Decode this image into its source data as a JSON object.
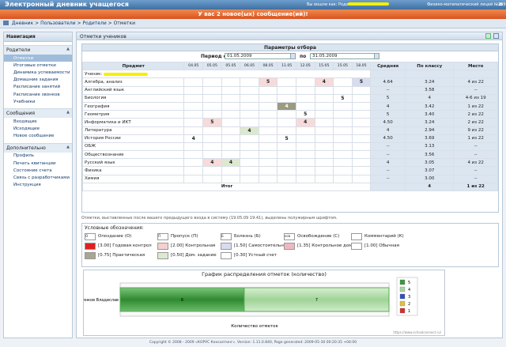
{
  "header": {
    "app_title": "Электронный дневник учащегося",
    "login_prefix": "Вы вошли как: Родители",
    "school": "Физико-математический лицей №239",
    "exit_label": "Выход"
  },
  "message_bar": "У вас 2 новое(ых) сообщение(ий)!",
  "breadcrumb": [
    "Дневник",
    "Пользователи",
    "Родители",
    "Отметки"
  ],
  "sidebar": {
    "title": "Навигация",
    "groups": [
      {
        "label": "Родители",
        "items": [
          "Отметки",
          "Итоговые отметки",
          "Динамика успеваемости",
          "Домашние задания",
          "Расписание занятий",
          "Расписание звонков",
          "Учебники"
        ]
      },
      {
        "label": "Сообщения",
        "items": [
          "Входящие",
          "Исходящие",
          "Новое сообщение"
        ]
      },
      {
        "label": "Дополнительно",
        "items": [
          "Профиль",
          "Печать квитанции",
          "Состояние счета",
          "Связь с разработчиками",
          "Инструкция"
        ]
      }
    ]
  },
  "main": {
    "title": "Отметки учеников",
    "params_title": "Параметры отбора",
    "period_from_label": "Период с",
    "period_from": "01.05.2009",
    "period_to_label": "по",
    "period_to": "31.05.2009"
  },
  "grades": {
    "headers": {
      "subject": "Предмет",
      "avg": "Средняя",
      "class": "По классу",
      "place": "Место"
    },
    "dates": [
      "04.05",
      "05.05",
      "05.05",
      "06.05",
      "08.05",
      "11.05",
      "12.05",
      "15.05",
      "15.05",
      "18.05"
    ],
    "pupil_label": "Ученик:",
    "total_label": "Итог",
    "total_class": "4",
    "total_place": "1 из 22",
    "rows": [
      {
        "subject": "Алгебра, анализ",
        "marks": {
          "4": {
            "v": "5",
            "c": "m-pink"
          },
          "7": {
            "v": "4",
            "c": "m-pink"
          },
          "9": {
            "v": "5",
            "c": "m-lav"
          }
        },
        "avg": "4.64",
        "cls": "3.24",
        "place": "4 из 22"
      },
      {
        "subject": "Английский язык",
        "marks": {},
        "avg": "--",
        "cls": "3.58",
        "place": "--"
      },
      {
        "subject": "Биология",
        "marks": {
          "8": {
            "v": "5",
            "c": ""
          }
        },
        "avg": "5",
        "cls": "4",
        "place": "4-6 из 19"
      },
      {
        "subject": "География",
        "marks": {
          "5": {
            "v": "4",
            "c": "m-olive"
          }
        },
        "avg": "4",
        "cls": "3.42",
        "place": "1 из 22"
      },
      {
        "subject": "Геометрия",
        "marks": {
          "6": {
            "v": "5",
            "c": ""
          }
        },
        "avg": "5",
        "cls": "3.40",
        "place": "2 из 22"
      },
      {
        "subject": "Информатика и ИКТ",
        "marks": {
          "1": {
            "v": "5",
            "c": "m-pink"
          },
          "6": {
            "v": "4",
            "c": "m-pink"
          }
        },
        "avg": "4.50",
        "cls": "3.24",
        "place": "2 из 22"
      },
      {
        "subject": "Литература",
        "marks": {
          "3": {
            "v": "4",
            "c": "m-green"
          }
        },
        "avg": "4",
        "cls": "2.94",
        "place": "9 из 22"
      },
      {
        "subject": "История России",
        "marks": {
          "0": {
            "v": "4",
            "c": ""
          },
          "5": {
            "v": "5",
            "c": ""
          }
        },
        "avg": "4.50",
        "cls": "3.69",
        "place": "1 из 22"
      },
      {
        "subject": "ОБЖ",
        "marks": {},
        "avg": "--",
        "cls": "3.13",
        "place": "--"
      },
      {
        "subject": "Обществознание",
        "marks": {},
        "avg": "--",
        "cls": "3.56",
        "place": "--"
      },
      {
        "subject": "Русский язык",
        "marks": {
          "1": {
            "v": "4",
            "c": "m-pink"
          },
          "2": {
            "v": "4",
            "c": "m-green"
          }
        },
        "avg": "4",
        "cls": "3.05",
        "place": "4 из 22"
      },
      {
        "subject": "Физика",
        "marks": {},
        "avg": "--",
        "cls": "3.07",
        "place": "--"
      },
      {
        "subject": "Химия",
        "marks": {},
        "avg": "--",
        "cls": "3.00",
        "place": "--"
      }
    ]
  },
  "note": "Отметки, выставленные после вашего предыдущего входа в систему (19.05.09 19:41), выделены полужирным шрифтом.",
  "legend": {
    "title": "Условные обозначения:",
    "items": [
      {
        "code": "О",
        "label": "Опоздание (О)"
      },
      {
        "code": "П",
        "label": "Пропуск (П)"
      },
      {
        "code": "Б",
        "label": "Болезнь (Б)"
      },
      {
        "code": "осв",
        "label": "Освобождение (С)"
      },
      {
        "code": "",
        "label": "Комментарий (К)"
      },
      {
        "code": "",
        "label": "[3.00] Годовая контрол"
      },
      {
        "code": "",
        "label": "[2.00] Контрольная"
      },
      {
        "code": "",
        "label": "[1.50] Самостоятельная"
      },
      {
        "code": "",
        "label": "[1.35] Контрольное дом"
      },
      {
        "code": "",
        "label": "[1.00] Обычная"
      },
      {
        "code": "",
        "label": "[0.75] Практическая"
      },
      {
        "code": "",
        "label": "[0.50] Дом. задание"
      },
      {
        "code": "",
        "label": "[0.30] Устный счет"
      }
    ],
    "colors": [
      "#e02020",
      "#f4d0d0",
      "#d8dcef",
      "#efb8c0",
      "#ffffff",
      "#a8a690",
      "#dde9cf",
      "#ffffff"
    ]
  },
  "chart_data": {
    "type": "bar",
    "title": "График распределения отметок (количество)",
    "xlabel": "Количество отметок",
    "categories": [
      "Пиянков Владислав"
    ],
    "series": [
      {
        "name": "5",
        "values": [
          6
        ],
        "color": "#3a9a3a"
      },
      {
        "name": "4",
        "values": [
          7
        ],
        "color": "#a8d8a0"
      },
      {
        "name": "3",
        "values": [
          0
        ],
        "color": "#3050c0"
      },
      {
        "name": "2",
        "values": [
          0
        ],
        "color": "#e0c040"
      },
      {
        "name": "1",
        "values": [
          0
        ],
        "color": "#d03030"
      }
    ],
    "xlim": [
      0,
      13
    ],
    "watermark": "https://www.schoolconnect.ru/"
  },
  "footer": "Copyright © 2008 - 2009 «КОРУС Консалтинг». Version: 1.11.0.840, Page generated: 2009-05-30 00:20:35 +04:00"
}
